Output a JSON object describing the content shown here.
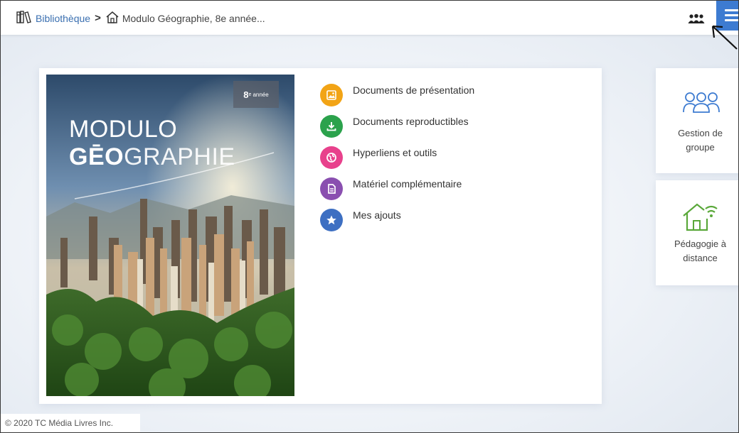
{
  "breadcrumb": {
    "library_label": "Bibliothèque",
    "separator": ">",
    "current_label": "Modulo Géographie, 8e année..."
  },
  "cover": {
    "grade_number": "8",
    "grade_sup": "e",
    "grade_word": "année",
    "title_line1": "MODULO",
    "title_line2_bold": "GĒO",
    "title_line2_rest": "GRAPHIE"
  },
  "menu": {
    "items": [
      {
        "label": "Documents de présentation",
        "color": "#f2a416",
        "icon": "image-icon"
      },
      {
        "label": "Documents reproductibles",
        "color": "#2ba24c",
        "icon": "download-icon"
      },
      {
        "label": "Hyperliens et outils",
        "color": "#e8418c",
        "icon": "globe-icon"
      },
      {
        "label": "Matériel complémentaire",
        "color": "#8a4fb0",
        "icon": "document-icon"
      },
      {
        "label": "Mes ajouts",
        "color": "#3d6fc2",
        "icon": "star-icon"
      }
    ]
  },
  "tiles": {
    "group": {
      "line1": "Gestion de",
      "line2": "groupe",
      "icon_color": "#3d7bd1"
    },
    "distance": {
      "line1": "Pédagogie à",
      "line2": "distance",
      "icon_color": "#5aa83a"
    }
  },
  "footer": {
    "copyright": "© 2020 TC Média Livres Inc."
  },
  "colors": {
    "accent": "#3d7bd1",
    "link": "#3a6fb0"
  }
}
